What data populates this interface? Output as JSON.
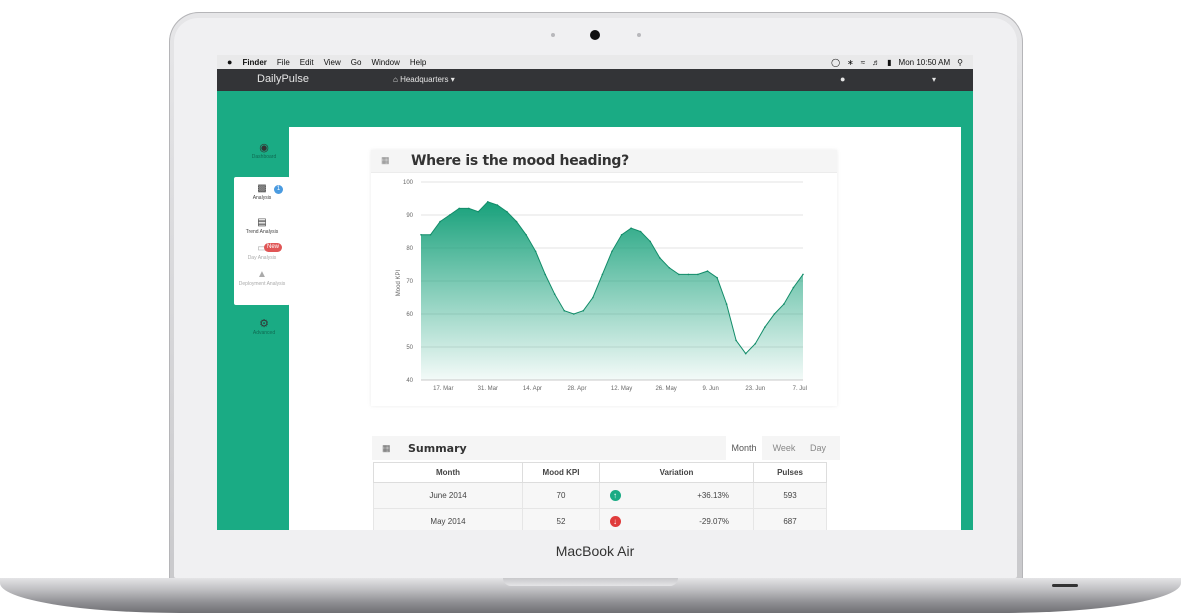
{
  "device": {
    "brand": "MacBook Air"
  },
  "menubar": {
    "items": [
      "Finder",
      "File",
      "Edit",
      "View",
      "Go",
      "Window",
      "Help"
    ],
    "clock": "Mon 10:50 AM",
    "icons": [
      "apple-icon",
      "notification-icon",
      "bluetooth-icon",
      "wifi-icon",
      "volume-icon",
      "battery-icon",
      "spotlight-icon"
    ]
  },
  "app": {
    "name": "DailyPulse",
    "location": "Headquarters",
    "accent": "#1aab84"
  },
  "sidebar": {
    "top": {
      "label": "Dashboard",
      "icon": "dashboard-icon"
    },
    "items": [
      {
        "label": "Analysis",
        "icon": "bar-chart-icon",
        "badge": "1"
      },
      {
        "label": "Trend Analysis",
        "icon": "trend-icon"
      },
      {
        "label": "Day Analysis",
        "icon": "toggle-icon",
        "badge": "New"
      },
      {
        "label": "Deployment Analysis",
        "icon": "road-icon"
      }
    ],
    "bottom": {
      "label": "Advanced",
      "icon": "gear-icon"
    }
  },
  "chart_card": {
    "title": "Where is the mood heading?"
  },
  "chart_data": {
    "type": "area",
    "title": "Where is the mood heading?",
    "ylabel": "Mood KPI",
    "xlabel": "",
    "ylim": [
      40,
      100
    ],
    "yticks": [
      40,
      50,
      60,
      70,
      80,
      90,
      100
    ],
    "xticks": [
      "17. Mar",
      "31. Mar",
      "14. Apr",
      "28. Apr",
      "12. May",
      "26. May",
      "9. Jun",
      "23. Jun",
      "7. Jul"
    ],
    "grid": true,
    "x": [
      "2014-03-10",
      "2014-03-13",
      "2014-03-16",
      "2014-03-19",
      "2014-03-22",
      "2014-03-25",
      "2014-03-28",
      "2014-03-31",
      "2014-04-03",
      "2014-04-06",
      "2014-04-09",
      "2014-04-12",
      "2014-04-15",
      "2014-04-18",
      "2014-04-21",
      "2014-04-24",
      "2014-04-27",
      "2014-04-30",
      "2014-05-03",
      "2014-05-06",
      "2014-05-09",
      "2014-05-12",
      "2014-05-15",
      "2014-05-18",
      "2014-05-21",
      "2014-05-24",
      "2014-05-27",
      "2014-05-30",
      "2014-06-02",
      "2014-06-05",
      "2014-06-08",
      "2014-06-11",
      "2014-06-14",
      "2014-06-17",
      "2014-06-20",
      "2014-06-23",
      "2014-06-26",
      "2014-06-29",
      "2014-07-02",
      "2014-07-05",
      "2014-07-08"
    ],
    "series": [
      {
        "values": [
          84,
          84,
          88,
          90,
          92,
          92,
          91,
          94,
          93,
          91,
          88,
          84,
          79,
          72,
          66,
          61,
          60,
          61,
          65,
          72,
          79,
          84,
          86,
          85,
          82,
          77,
          74,
          72,
          72,
          72,
          73,
          71,
          63,
          52,
          48,
          51,
          56,
          60,
          63,
          68,
          72
        ]
      }
    ]
  },
  "summary": {
    "title": "Summary",
    "tabs": [
      "Month",
      "Week",
      "Day"
    ],
    "columns": [
      "Month",
      "Mood KPI",
      "Variation",
      "Pulses"
    ],
    "rows": [
      {
        "month": "June 2014",
        "kpi": "70",
        "direction": "up",
        "variation": "+36.13%",
        "pulses": "593"
      },
      {
        "month": "May 2014",
        "kpi": "52",
        "direction": "down",
        "variation": "-29.07%",
        "pulses": "687"
      }
    ],
    "colors": {
      "up": "#1aab84",
      "down": "#e03c3c"
    }
  }
}
